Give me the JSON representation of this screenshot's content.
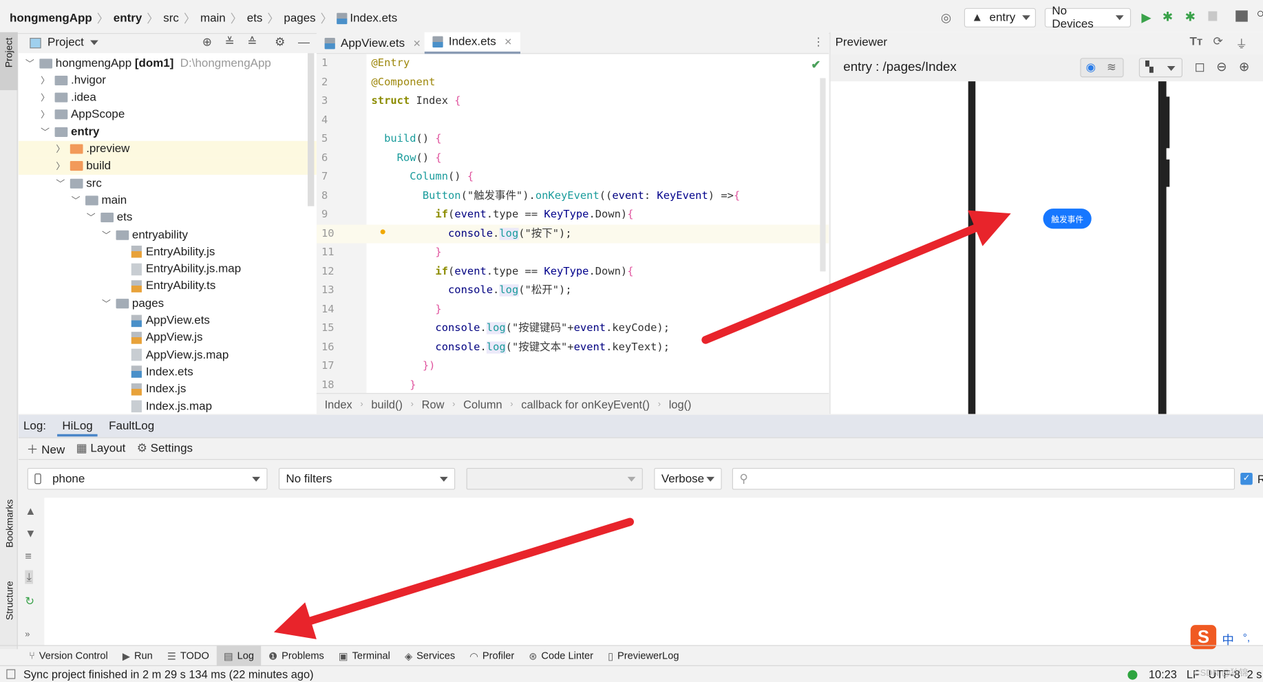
{
  "breadcrumb": [
    "hongmengApp",
    "entry",
    "src",
    "main",
    "ets",
    "pages",
    "Index.ets"
  ],
  "toolbar": {
    "entry_label": "entry",
    "device_label": "No Devices"
  },
  "project_panel": {
    "title": "Project"
  },
  "side_strip": {
    "project": "Project",
    "bookmarks": "Bookmarks",
    "structure": "Structure"
  },
  "tree": [
    {
      "label": "hongmengApp",
      "bold_suffix": "[dom1]",
      "path": "D:\\hongmengApp",
      "level": 0,
      "kind": "module",
      "open": true
    },
    {
      "label": ".hvigor",
      "level": 1,
      "kind": "folder",
      "open": false
    },
    {
      "label": ".idea",
      "level": 1,
      "kind": "folder",
      "open": false
    },
    {
      "label": "AppScope",
      "level": 1,
      "kind": "folder",
      "open": false
    },
    {
      "label": "entry",
      "level": 1,
      "kind": "module",
      "open": true,
      "bold": true
    },
    {
      "label": ".preview",
      "level": 2,
      "kind": "folder-excluded",
      "open": false,
      "highlight": true
    },
    {
      "label": "build",
      "level": 2,
      "kind": "folder-excluded",
      "open": false,
      "highlight": true
    },
    {
      "label": "src",
      "level": 2,
      "kind": "folder",
      "open": true
    },
    {
      "label": "main",
      "level": 3,
      "kind": "folder",
      "open": true
    },
    {
      "label": "ets",
      "level": 4,
      "kind": "folder",
      "open": true
    },
    {
      "label": "entryability",
      "level": 5,
      "kind": "folder",
      "open": true
    },
    {
      "label": "EntryAbility.js",
      "level": 6,
      "kind": "js"
    },
    {
      "label": "EntryAbility.js.map",
      "level": 6,
      "kind": "map"
    },
    {
      "label": "EntryAbility.ts",
      "level": 6,
      "kind": "ts"
    },
    {
      "label": "pages",
      "level": 5,
      "kind": "folder",
      "open": true
    },
    {
      "label": "AppView.ets",
      "level": 6,
      "kind": "ets"
    },
    {
      "label": "AppView.js",
      "level": 6,
      "kind": "js"
    },
    {
      "label": "AppView.js.map",
      "level": 6,
      "kind": "map"
    },
    {
      "label": "Index.ets",
      "level": 6,
      "kind": "ets"
    },
    {
      "label": "Index.js",
      "level": 6,
      "kind": "js"
    },
    {
      "label": "Index.js.map",
      "level": 6,
      "kind": "map"
    }
  ],
  "editor_tabs": [
    {
      "label": "AppView.ets",
      "active": false
    },
    {
      "label": "Index.ets",
      "active": true
    }
  ],
  "code": [
    {
      "n": "1",
      "tokens": [
        [
          "@Entry",
          "ann"
        ]
      ]
    },
    {
      "n": "2",
      "tokens": [
        [
          "@Component",
          "ann"
        ]
      ]
    },
    {
      "n": "3",
      "tokens": [
        [
          "struct",
          "kw"
        ],
        [
          " Index ",
          "plain"
        ],
        [
          "{",
          "br"
        ]
      ]
    },
    {
      "n": "4",
      "tokens": []
    },
    {
      "n": "5",
      "tokens": [
        [
          "  build",
          "fn"
        ],
        [
          "() ",
          "plain"
        ],
        [
          "{",
          "br"
        ]
      ]
    },
    {
      "n": "6",
      "tokens": [
        [
          "    Row",
          "fn"
        ],
        [
          "() ",
          "plain"
        ],
        [
          "{",
          "br"
        ]
      ]
    },
    {
      "n": "7",
      "tokens": [
        [
          "      Column",
          "fn"
        ],
        [
          "() ",
          "plain"
        ],
        [
          "{",
          "br"
        ]
      ]
    },
    {
      "n": "8",
      "tokens": [
        [
          "        Button",
          "fn"
        ],
        [
          "(",
          "plain"
        ],
        [
          "\"触发事件\"",
          "str"
        ],
        [
          ").",
          "plain"
        ],
        [
          "onKeyEvent",
          "fn"
        ],
        [
          "((",
          "plain"
        ],
        [
          "event",
          "id"
        ],
        [
          ": ",
          "plain"
        ],
        [
          "KeyEvent",
          "type"
        ],
        [
          ") =>",
          "plain"
        ],
        [
          "{",
          "br"
        ]
      ]
    },
    {
      "n": "9",
      "tokens": [
        [
          "          if",
          "kw"
        ],
        [
          "(",
          "plain"
        ],
        [
          "event",
          "id"
        ],
        [
          ".type == ",
          "plain"
        ],
        [
          "KeyType",
          "type"
        ],
        [
          ".Down)",
          "plain"
        ],
        [
          "{",
          "br"
        ]
      ]
    },
    {
      "n": "10",
      "current": true,
      "tokens": [
        [
          "            console",
          "id"
        ],
        [
          ".",
          "plain"
        ],
        [
          "log",
          "log"
        ],
        [
          "(",
          "plain"
        ],
        [
          "\"按下\"",
          "str"
        ],
        [
          ");",
          "plain"
        ]
      ]
    },
    {
      "n": "11",
      "tokens": [
        [
          "          }",
          "br"
        ]
      ]
    },
    {
      "n": "12",
      "tokens": [
        [
          "          if",
          "kw"
        ],
        [
          "(",
          "plain"
        ],
        [
          "event",
          "id"
        ],
        [
          ".type == ",
          "plain"
        ],
        [
          "KeyType",
          "type"
        ],
        [
          ".Down)",
          "plain"
        ],
        [
          "{",
          "br"
        ]
      ]
    },
    {
      "n": "13",
      "tokens": [
        [
          "            console",
          "id"
        ],
        [
          ".",
          "plain"
        ],
        [
          "log",
          "log"
        ],
        [
          "(",
          "plain"
        ],
        [
          "\"松开\"",
          "str"
        ],
        [
          ");",
          "plain"
        ]
      ]
    },
    {
      "n": "14",
      "tokens": [
        [
          "          }",
          "br"
        ]
      ]
    },
    {
      "n": "15",
      "tokens": [
        [
          "          console",
          "id"
        ],
        [
          ".",
          "plain"
        ],
        [
          "log",
          "log"
        ],
        [
          "(",
          "plain"
        ],
        [
          "\"按键键码\"",
          "str"
        ],
        [
          "+",
          "plain"
        ],
        [
          "event",
          "id"
        ],
        [
          ".keyCode);",
          "plain"
        ]
      ]
    },
    {
      "n": "16",
      "tokens": [
        [
          "          console",
          "id"
        ],
        [
          ".",
          "plain"
        ],
        [
          "log",
          "log"
        ],
        [
          "(",
          "plain"
        ],
        [
          "\"按键文本\"",
          "str"
        ],
        [
          "+",
          "plain"
        ],
        [
          "event",
          "id"
        ],
        [
          ".keyText);",
          "plain"
        ]
      ]
    },
    {
      "n": "17",
      "tokens": [
        [
          "        })",
          "br"
        ]
      ]
    },
    {
      "n": "18",
      "tokens": [
        [
          "      }",
          "br"
        ]
      ]
    }
  ],
  "editor_breadcrumb": [
    "Index",
    "build()",
    "Row",
    "Column",
    "callback for onKeyEvent()",
    "log()"
  ],
  "previewer": {
    "title": "Previewer",
    "route": "entry : /pages/Index",
    "button_label": "触发事件",
    "button_color": "#1677ff"
  },
  "log": {
    "label": "Log:",
    "tabs": [
      {
        "label": "HiLog",
        "active": true
      },
      {
        "label": "FaultLog",
        "active": false
      }
    ],
    "actions": {
      "new": "New",
      "layout": "Layout",
      "settings": "Settings"
    },
    "device": "phone",
    "filter": "No filters",
    "process": "",
    "level": "Verbose",
    "search_placeholder": "",
    "regex_checked": true,
    "regex_label": "R"
  },
  "bottom_tabs": [
    {
      "label": "Version Control"
    },
    {
      "label": "Run"
    },
    {
      "label": "TODO"
    },
    {
      "label": "Log",
      "active": true
    },
    {
      "label": "Problems"
    },
    {
      "label": "Terminal"
    },
    {
      "label": "Services"
    },
    {
      "label": "Profiler"
    },
    {
      "label": "Code Linter"
    },
    {
      "label": "PreviewerLog"
    }
  ],
  "status": {
    "message": "Sync project finished in 2 m 29 s 134 ms (22 minutes ago)",
    "time": "10:23",
    "line_sep": "LF",
    "encoding": "UTF-8",
    "indent": "2 s",
    "watermark": "CSDN @狄锦"
  },
  "ime": {
    "lang": "中",
    "punct": "°,"
  },
  "annotation_color": "#e8242b"
}
